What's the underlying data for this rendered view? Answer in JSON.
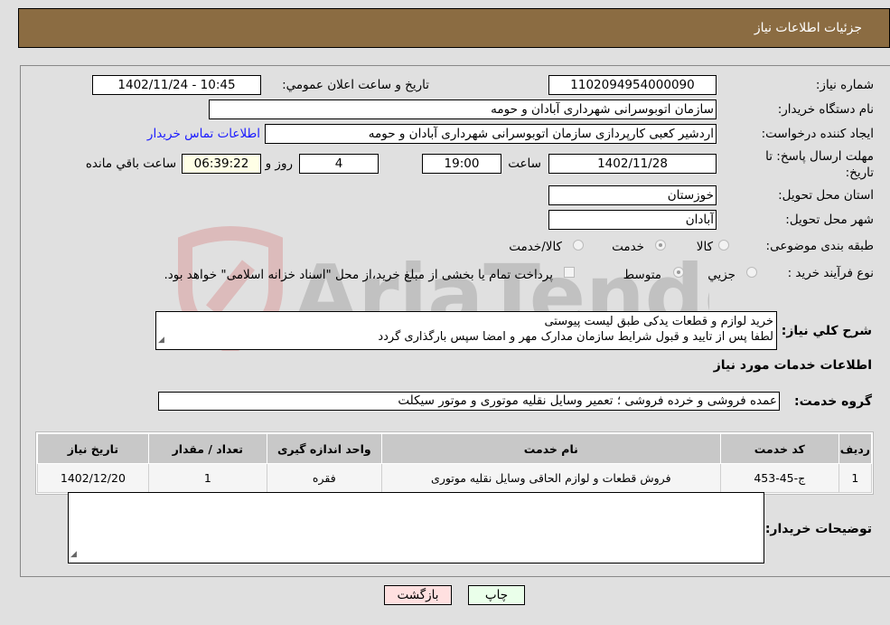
{
  "header": {
    "title": "جزئیات اطلاعات نیاز"
  },
  "fields": {
    "need_number": {
      "label": "شماره نیاز:",
      "value": "1102094954000090"
    },
    "announce_datetime": {
      "label": "تاريخ و ساعت اعلان عمومي:",
      "value": "1402/11/24 - 10:45"
    },
    "buyer_org": {
      "label": "نام دستگاه خریدار:",
      "value": "سازمان اتوبوسرانی شهرداری آبادان و حومه"
    },
    "requester": {
      "label": "ایجاد کننده درخواست:",
      "value": "اردشیر کعبی کارپردازی سازمان اتوبوسرانی شهرداری آبادان و حومه"
    },
    "buyer_contact_link": "اطلاعات تماس خریدار",
    "deadline": {
      "label": "مهلت ارسال پاسخ: تا تاریخ:",
      "date": "1402/11/28",
      "time_label": "ساعت",
      "time": "19:00",
      "days": "4",
      "days_label": "روز و",
      "remaining": "06:39:22",
      "remaining_label": "ساعت باقي مانده"
    },
    "province": {
      "label": "استان محل تحویل:",
      "value": "خوزستان"
    },
    "city": {
      "label": "شهر محل تحویل:",
      "value": "آبادان"
    },
    "category": {
      "label": "طبقه بندی موضوعی:",
      "options": [
        {
          "label": "کالا",
          "checked": false
        },
        {
          "label": "خدمت",
          "checked": true
        },
        {
          "label": "کالا/خدمت",
          "checked": false
        }
      ]
    },
    "purchase_process": {
      "label": "نوع فرآیند خرید :",
      "options": [
        {
          "label": "جزيي",
          "checked": false
        },
        {
          "label": "متوسط",
          "checked": true
        }
      ],
      "checkbox_label": "پرداخت تمام یا بخشی از مبلغ خرید،از محل \"اسناد خزانه اسلامی\" خواهد بود."
    }
  },
  "description": {
    "label": "شرح کلي نیاز:",
    "lines": [
      "خرید لوازم و قطعات یدکی طبق لیست پیوستی",
      "لطفا پس از تایید و قبول شرایط سازمان مدارک مهر و امضا سپس بارگذاری گردد"
    ]
  },
  "services_section_title": "اطلاعات خدمات مورد نیاز",
  "service_group": {
    "label": "گروه خدمت:",
    "value": "عمده فروشی و خرده فروشی ؛ تعمیر وسایل نقلیه موتوری و موتور سیکلت"
  },
  "table": {
    "headers": [
      "ردیف",
      "کد خدمت",
      "نام خدمت",
      "واحد اندازه گیری",
      "تعداد / مقدار",
      "تاریخ نیاز"
    ],
    "rows": [
      [
        "1",
        "ج-45-453",
        "فروش قطعات و لوازم الحاقی وسایل نقلیه موتوری",
        "فقره",
        "1",
        "1402/12/20"
      ]
    ]
  },
  "buyer_notes": {
    "label": "توضیحات خریدار:",
    "value": ""
  },
  "buttons": {
    "print": "چاپ",
    "back": "بازگشت"
  },
  "watermark": "AriaTender.neT",
  "colors": {
    "header_bg": "#8b6c42",
    "print_bg": "#eaffea",
    "back_bg": "#ffe0e0",
    "link": "#1a1aff"
  }
}
